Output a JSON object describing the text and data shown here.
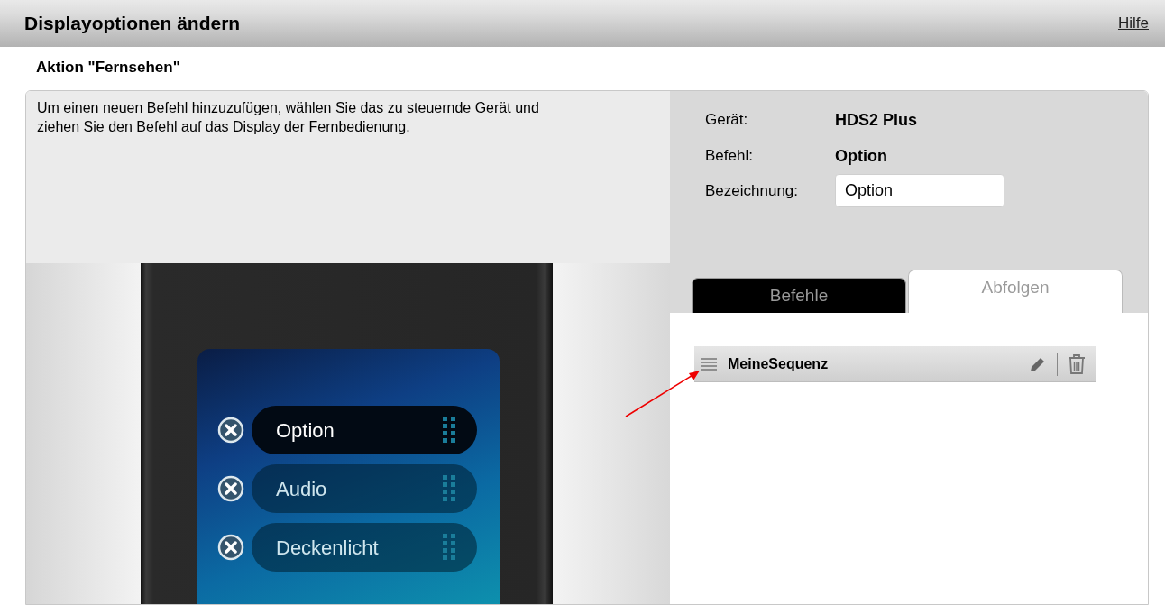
{
  "header": {
    "title": "Displayoptionen ändern",
    "help_link": "Hilfe"
  },
  "subtitle": "Aktion \"Fernsehen\"",
  "instructions": "Um einen neuen Befehl hinzuzufügen, wählen Sie das zu steuernde Gerät und ziehen Sie den Befehl auf das Display der Fernbedienung.",
  "remote_display": {
    "items": [
      {
        "label": "Option",
        "selected": true
      },
      {
        "label": "Audio",
        "selected": false
      },
      {
        "label": "Deckenlicht",
        "selected": false
      }
    ]
  },
  "details": {
    "fields": [
      {
        "label": "Gerät:",
        "value": "HDS2 Plus"
      },
      {
        "label": "Befehl:",
        "value": "Option"
      }
    ],
    "name_field": {
      "label": "Bezeichnung:",
      "value": "Option"
    }
  },
  "tabs": [
    {
      "label": "Befehle",
      "selected": false
    },
    {
      "label": "Abfolgen",
      "selected": true
    }
  ],
  "sequences": [
    {
      "name": "MeineSequenz"
    }
  ]
}
